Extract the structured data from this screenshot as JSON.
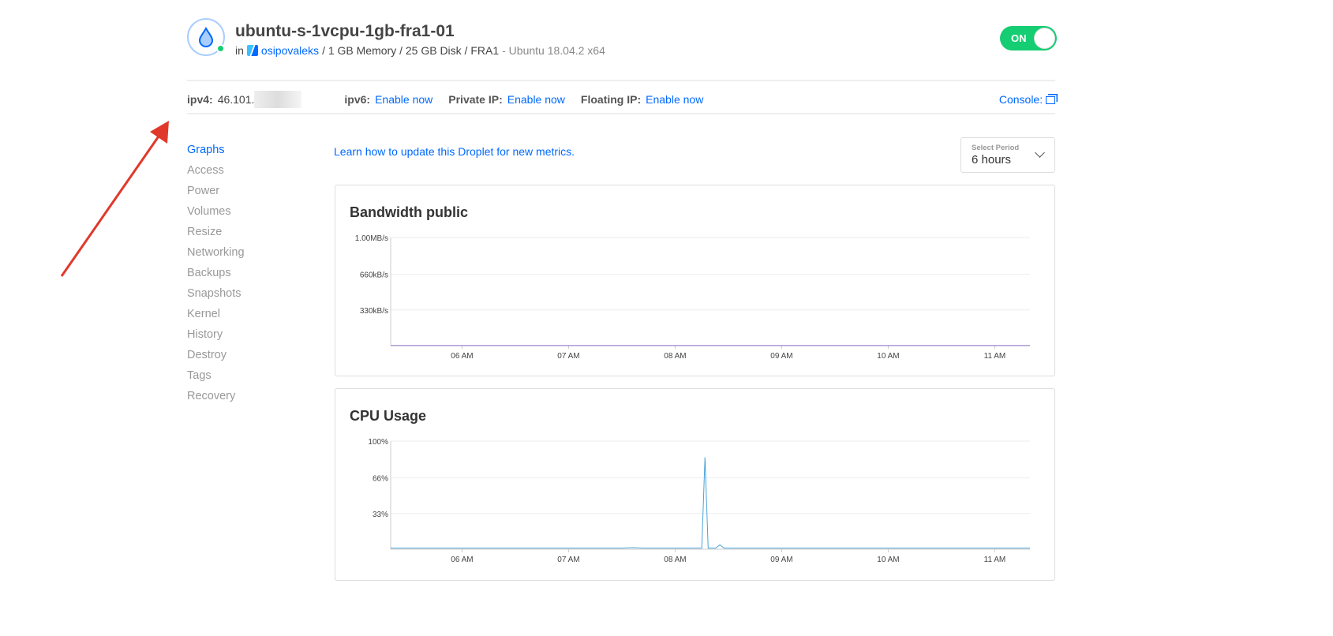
{
  "droplet": {
    "name": "ubuntu-s-1vcpu-1gb-fra1-01",
    "in_label": "in",
    "project": "osipovaleks",
    "specs": "/ 1 GB Memory / 25 GB Disk / FRA1",
    "os": "- Ubuntu 18.04.2 x64",
    "power_toggle": "ON",
    "status_color": "#15cd72"
  },
  "network": {
    "ipv4_label": "ipv4:",
    "ipv4_value": "46.101.",
    "ipv6_label": "ipv6:",
    "ipv6_link": "Enable now",
    "private_label": "Private IP:",
    "private_link": "Enable now",
    "floating_label": "Floating IP:",
    "floating_link": "Enable now",
    "console": "Console:"
  },
  "sidebar": {
    "items": [
      {
        "label": "Graphs",
        "active": true
      },
      {
        "label": "Access"
      },
      {
        "label": "Power"
      },
      {
        "label": "Volumes"
      },
      {
        "label": "Resize"
      },
      {
        "label": "Networking"
      },
      {
        "label": "Backups"
      },
      {
        "label": "Snapshots"
      },
      {
        "label": "Kernel"
      },
      {
        "label": "History"
      },
      {
        "label": "Destroy"
      },
      {
        "label": "Tags"
      },
      {
        "label": "Recovery"
      }
    ]
  },
  "main": {
    "learn_link": "Learn how to update this Droplet for new metrics.",
    "period_label": "Select Period",
    "period_value": "6 hours"
  },
  "chart_data": [
    {
      "type": "line",
      "title": "Bandwidth public",
      "x_ticks": [
        "06 AM",
        "07 AM",
        "08 AM",
        "09 AM",
        "10 AM",
        "11 AM"
      ],
      "xlim_hours": [
        5.33,
        11.33
      ],
      "y_ticks": [
        {
          "v": 330,
          "label": "330kB/s"
        },
        {
          "v": 660,
          "label": "660kB/s"
        },
        {
          "v": 1000,
          "label": "1.00MB/s"
        }
      ],
      "ylim": [
        0,
        1000
      ],
      "series": [
        {
          "name": "public",
          "color": "#8b6fc9",
          "points": [
            [
              5.33,
              1
            ],
            [
              11.33,
              1
            ]
          ]
        }
      ]
    },
    {
      "type": "line",
      "title": "CPU Usage",
      "x_ticks": [
        "06 AM",
        "07 AM",
        "08 AM",
        "09 AM",
        "10 AM",
        "11 AM"
      ],
      "xlim_hours": [
        5.33,
        11.33
      ],
      "y_ticks": [
        {
          "v": 33,
          "label": "33%"
        },
        {
          "v": 66,
          "label": "66%"
        },
        {
          "v": 100,
          "label": "100%"
        }
      ],
      "ylim": [
        0,
        100
      ],
      "series": [
        {
          "name": "cpu",
          "color": "#4aa3d8",
          "points": [
            [
              5.33,
              1
            ],
            [
              7.5,
              1
            ],
            [
              7.6,
              1.5
            ],
            [
              7.7,
              1
            ],
            [
              8.25,
              1
            ],
            [
              8.28,
              85
            ],
            [
              8.31,
              1
            ],
            [
              8.38,
              1
            ],
            [
              8.42,
              4
            ],
            [
              8.46,
              1
            ],
            [
              11.33,
              1
            ]
          ]
        }
      ]
    }
  ]
}
